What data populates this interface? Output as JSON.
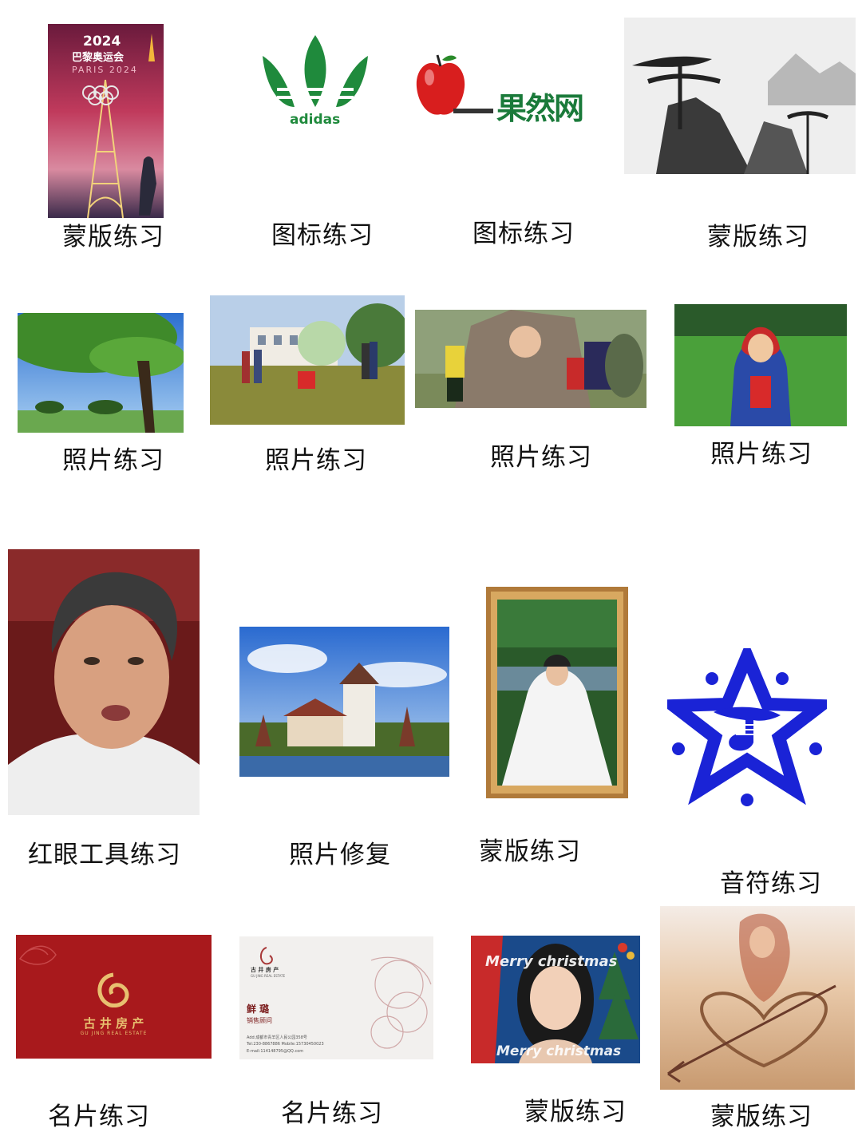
{
  "row1": {
    "paris_poster": {
      "caption": "蒙版练习",
      "year": "2024",
      "title": "巴黎奥运会",
      "subtitle": "PARIS 2024"
    },
    "adidas_logo": {
      "caption": "图标练习",
      "brand": "adidas"
    },
    "apple_logo": {
      "caption": "图标练习",
      "brand": "果然网"
    },
    "mountain_pines": {
      "caption": "蒙版练习"
    }
  },
  "row2": {
    "tree_sky": {
      "caption": "照片练习"
    },
    "park_family": {
      "caption": "照片练习"
    },
    "rock_children": {
      "caption": "照片练习"
    },
    "baby_grass": {
      "caption": "照片练习"
    }
  },
  "row3": {
    "man_portrait": {
      "caption": "红眼工具练习"
    },
    "castle_lake": {
      "caption": "照片修复"
    },
    "bride_frame": {
      "caption": "蒙版练习"
    },
    "star_note_logo": {
      "caption": "音符练习"
    }
  },
  "row4": {
    "red_card": {
      "caption": "名片练习",
      "company": "古 井 房 产",
      "company_en": "GU JING REAL ESTATE"
    },
    "white_card": {
      "caption": "名片练习",
      "company": "古 井 房 产",
      "company_en": "GU JING REAL ESTATE",
      "name": "鲜 璐",
      "title": "销售顾问",
      "address": "Add:成都市青羊区人民公园358号",
      "phone": "Tel:230-8867886   Mobile:15730450023",
      "email": "E-mail:114148795@QQ.com"
    },
    "christmas_card": {
      "caption": "蒙版练习",
      "greeting_top": "Merry christmas",
      "greeting_bottom": "Merry christmas"
    },
    "sand_heart": {
      "caption": "蒙版练习"
    }
  },
  "colors": {
    "adidas_green": "#1f8a3c",
    "apple_red": "#d81e1e",
    "logo_green": "#1a7a3a",
    "star_blue": "#1a23d6",
    "card_red": "#a8191c"
  }
}
